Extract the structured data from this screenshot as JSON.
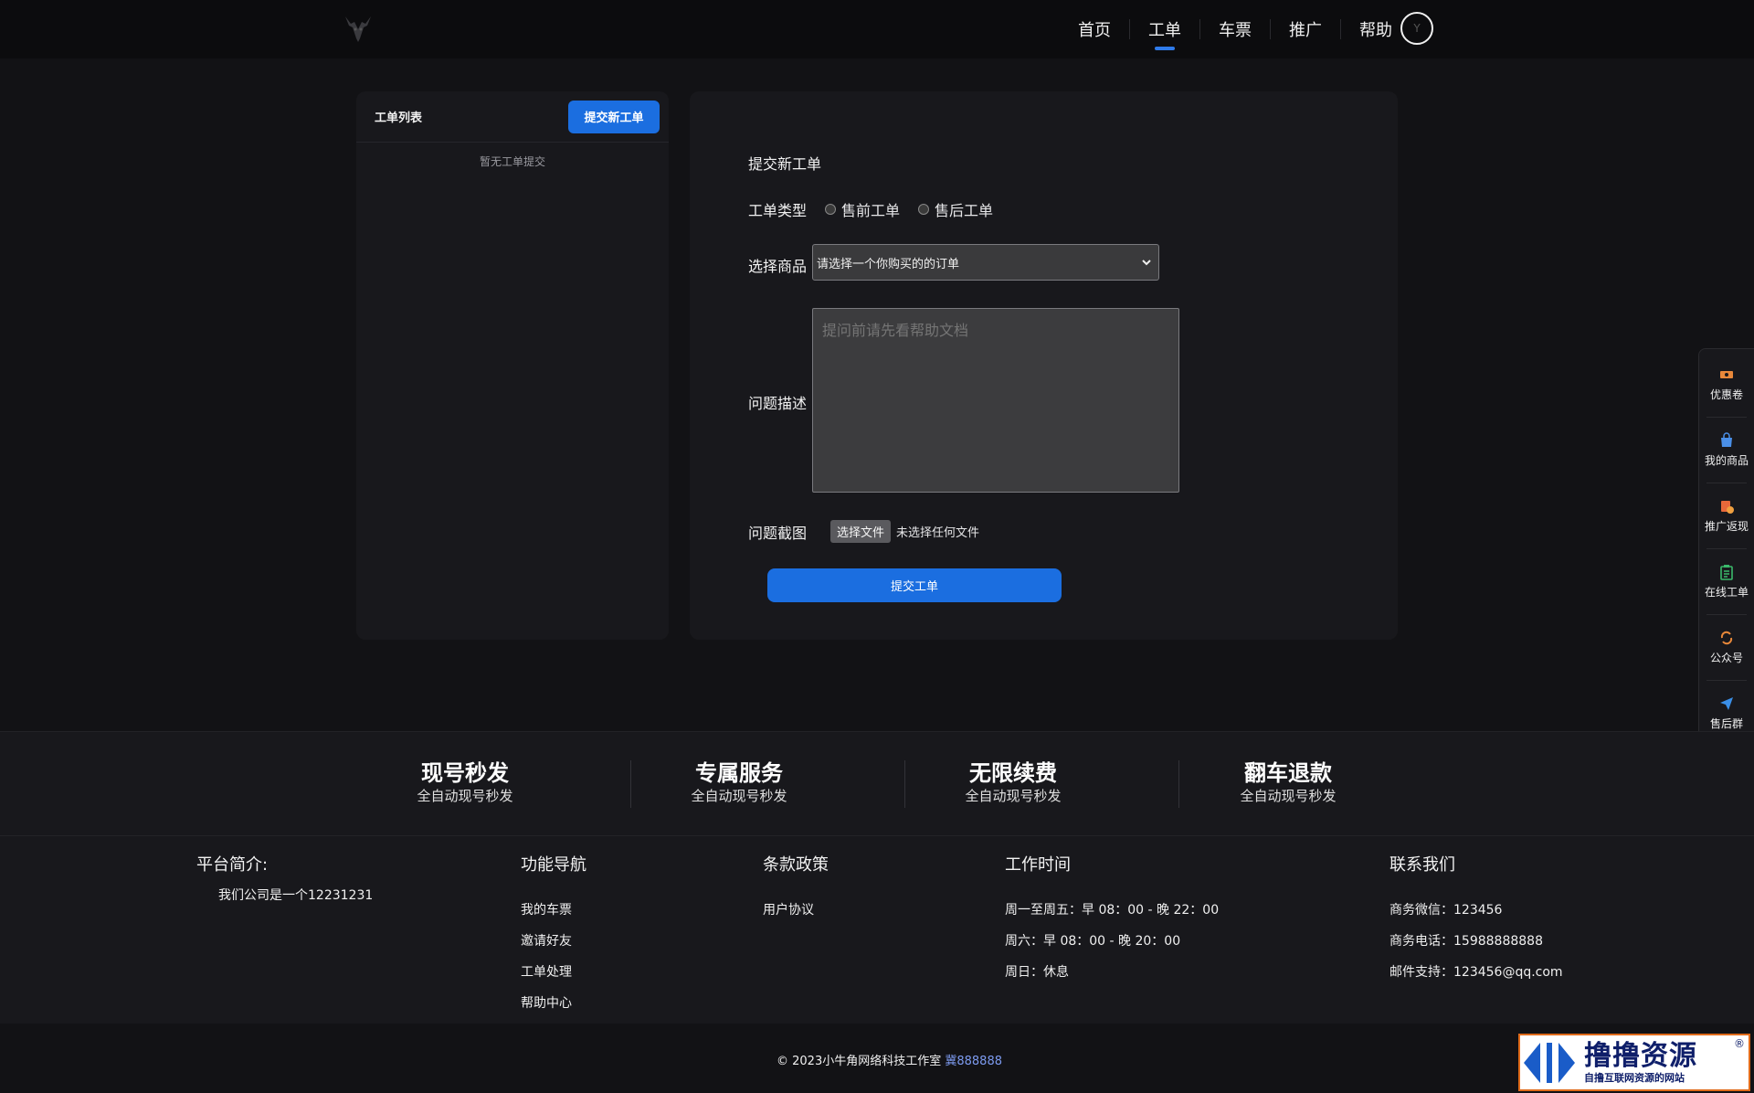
{
  "header": {
    "nav": [
      {
        "label": "首页"
      },
      {
        "label": "工单",
        "active": true
      },
      {
        "label": "车票"
      },
      {
        "label": "推广"
      },
      {
        "label": "帮助"
      }
    ],
    "user_initial": "Y"
  },
  "ticket_list": {
    "title": "工单列表",
    "new_button": "提交新工单",
    "empty_text": "暂无工单提交"
  },
  "form": {
    "title": "提交新工单",
    "type_label": "工单类型",
    "type_options": [
      "售前工单",
      "售后工单"
    ],
    "product_label": "选择商品",
    "product_value": "请选择一个你购买的的订单",
    "desc_label": "问题描述",
    "desc_placeholder": "提问前请先看帮助文档",
    "screenshot_label": "问题截图",
    "file_button": "选择文件",
    "file_status": "未选择任何文件",
    "submit_button": "提交工单"
  },
  "float_sidebar": [
    {
      "label": "优惠卷",
      "icon": "ticket-icon",
      "color": "#e8883a"
    },
    {
      "label": "我的商品",
      "icon": "bag-icon",
      "color": "#4a8fe8"
    },
    {
      "label": "推广返现",
      "icon": "gift-icon",
      "color": "#e8683a"
    },
    {
      "label": "在线工单",
      "icon": "clipboard-icon",
      "color": "#3ab86a"
    },
    {
      "label": "公众号",
      "icon": "refresh-icon",
      "color": "#e8883a"
    },
    {
      "label": "售后群",
      "icon": "send-icon",
      "color": "#3a8fe8"
    }
  ],
  "features": [
    {
      "title": "现号秒发",
      "sub": "全自动现号秒发"
    },
    {
      "title": "专属服务",
      "sub": "全自动现号秒发"
    },
    {
      "title": "无限续费",
      "sub": "全自动现号秒发"
    },
    {
      "title": "翻车退款",
      "sub": "全自动现号秒发"
    }
  ],
  "footer": {
    "about": {
      "title": "平台简介:",
      "text": "我们公司是一个12231231"
    },
    "nav": {
      "title": "功能导航",
      "links": [
        "我的车票",
        "邀请好友",
        "工单处理",
        "帮助中心"
      ]
    },
    "policy": {
      "title": "条款政策",
      "links": [
        "用户协议"
      ]
    },
    "hours": {
      "title": "工作时间",
      "lines": [
        "周一至周五：早 08：00 - 晚 22：00",
        "周六：早 08：00 - 晚 20：00",
        "周日：休息"
      ]
    },
    "contact": {
      "title": "联系我们",
      "lines": [
        "商务微信：123456",
        "商务电话：15988888888",
        "邮件支持：123456@qq.com"
      ]
    },
    "copyright": "© 2023小牛角网络科技工作室",
    "icp": "冀888888"
  },
  "watermark": {
    "main": "撸撸资源",
    "sub": "自撸互联网资源的网站",
    "reg": "®"
  },
  "colors": {
    "accent": "#1b6ee0",
    "background": "#121215",
    "panel": "#18181c"
  }
}
